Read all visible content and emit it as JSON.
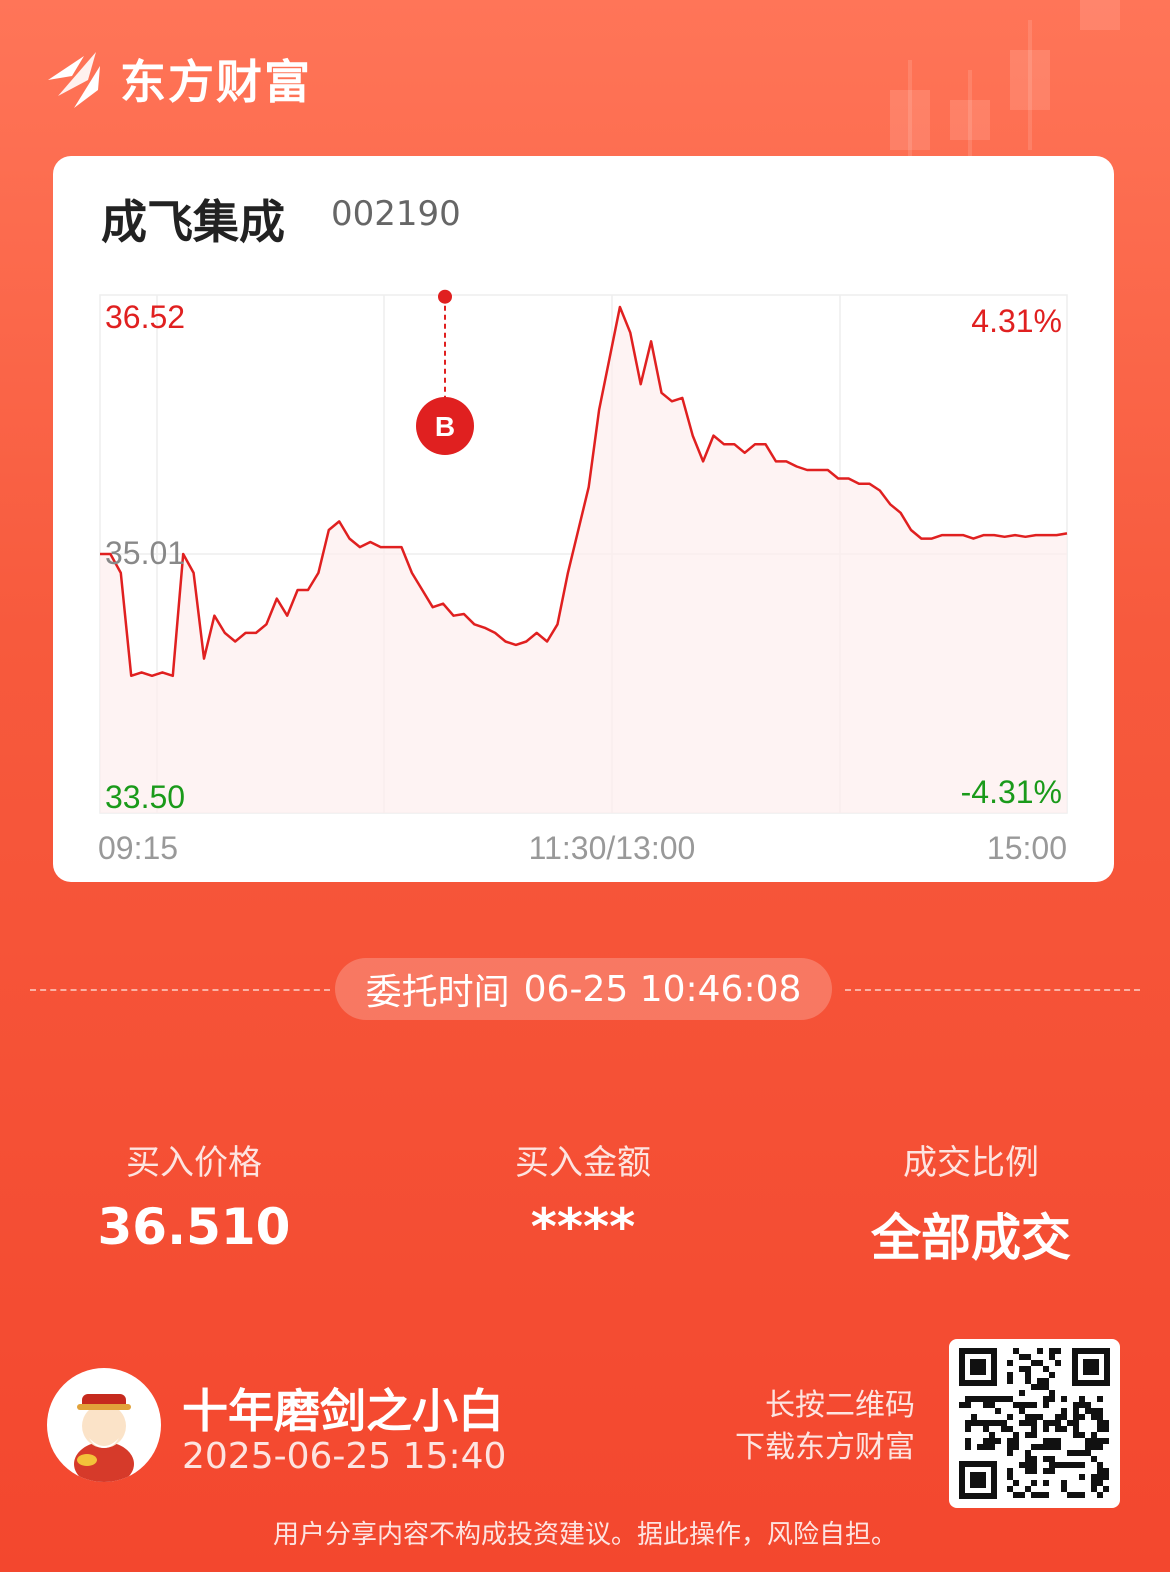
{
  "brand": {
    "name": "东方财富"
  },
  "stock": {
    "name": "成飞集成",
    "code": "002190"
  },
  "chart_data": {
    "type": "line",
    "x_ticks": [
      "09:15",
      "11:30/13:00",
      "15:00"
    ],
    "y_ticks_left": [
      "36.52",
      "35.01",
      "33.50"
    ],
    "y_ticks_right": [
      "4.31%",
      "-4.31%"
    ],
    "ylim": [
      33.5,
      36.52
    ],
    "prev_close": 35.01,
    "series": [
      {
        "values": [
          35.01,
          35.01,
          34.9,
          34.3,
          34.32,
          34.3,
          34.32,
          34.3,
          35.01,
          34.9,
          34.4,
          34.65,
          34.55,
          34.5,
          34.55,
          34.55,
          34.6,
          34.75,
          34.65,
          34.8,
          34.8,
          34.9,
          35.15,
          35.2,
          35.1,
          35.05,
          35.08,
          35.05,
          35.05,
          35.05,
          34.9,
          34.8,
          34.7,
          34.72,
          34.65,
          34.66,
          34.6,
          34.58,
          34.55,
          34.5,
          34.48,
          34.5,
          34.55,
          34.5,
          34.6,
          34.9,
          35.15,
          35.4,
          35.85,
          36.15,
          36.45,
          36.3,
          36.0,
          36.25,
          35.95,
          35.9,
          35.92,
          35.7,
          35.55,
          35.7,
          35.65,
          35.65,
          35.6,
          35.65,
          35.65,
          35.55,
          35.55,
          35.52,
          35.5,
          35.5,
          35.5,
          35.45,
          35.45,
          35.42,
          35.42,
          35.38,
          35.3,
          35.25,
          35.15,
          35.1,
          35.1,
          35.12,
          35.12,
          35.12,
          35.1,
          35.12,
          35.12,
          35.11,
          35.12,
          35.11,
          35.12,
          35.12,
          35.12,
          35.13
        ]
      }
    ],
    "markers": [
      {
        "label": "B",
        "price": 36.51
      }
    ]
  },
  "order": {
    "time_label": "委托时间",
    "time_value": "06-25 10:46:08",
    "buy_price_label": "买入价格",
    "buy_price": "36.510",
    "buy_amount_label": "买入金额",
    "buy_amount": "****",
    "fill_ratio_label": "成交比例",
    "fill_ratio": "全部成交"
  },
  "user": {
    "name": "十年磨剑之小白",
    "datetime": "2025-06-25 15:40"
  },
  "qr": {
    "hint_line1": "长按二维码",
    "hint_line2": "下载东方财富"
  },
  "disclaimer": "用户分享内容不构成投资建议。据此操作，风险自担。",
  "colors": {
    "up": "#e02020",
    "down": "#1a9a1a",
    "grid": "#eeeeee",
    "fill": "#fdeeee"
  }
}
